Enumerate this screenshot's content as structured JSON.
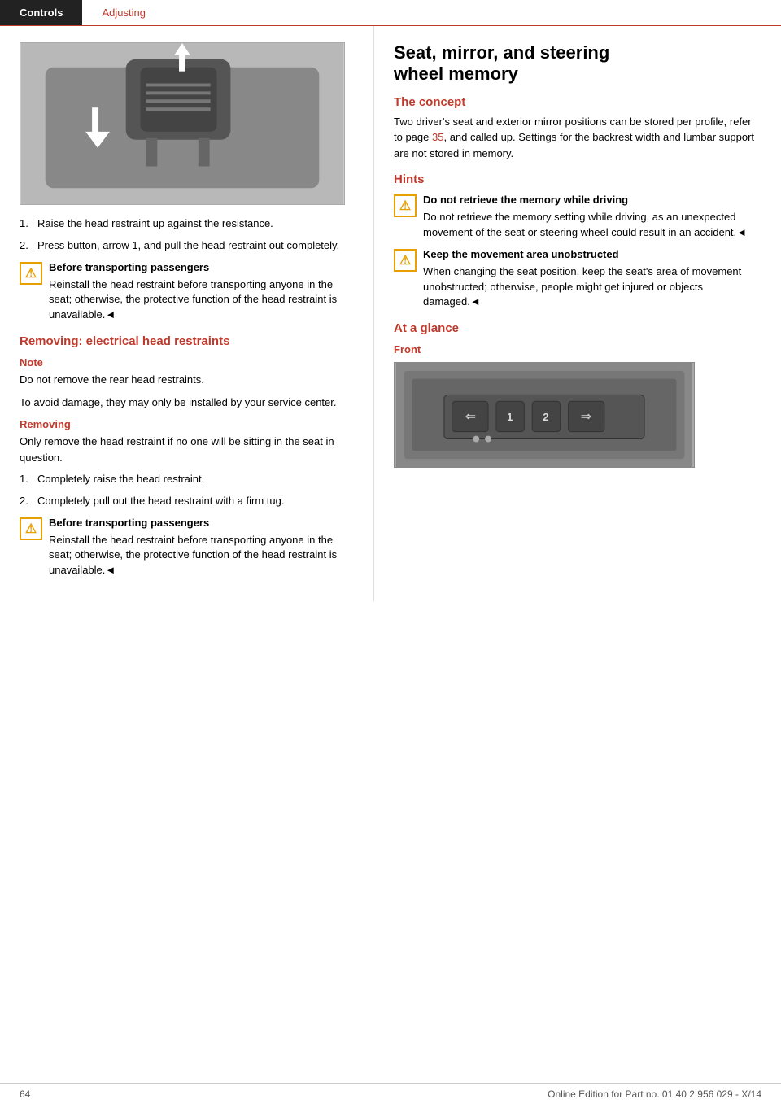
{
  "nav": {
    "tab1": "Controls",
    "tab2": "Adjusting"
  },
  "left": {
    "steps_remove_manual": [
      {
        "num": "1.",
        "text": "Raise the head restraint up against the resistance."
      },
      {
        "num": "2.",
        "text": "Press button, arrow 1, and pull the head restraint out completely."
      }
    ],
    "warning1": {
      "title": "Before transporting passengers",
      "text": "Reinstall the head restraint before transporting anyone in the seat; otherwise, the protective function of the head restraint is unavailable.◄"
    },
    "section_electrical": "Removing: electrical head restraints",
    "note_label": "Note",
    "note_text1": "Do not remove the rear head restraints.",
    "note_text2": "To avoid damage, they may only be installed by your service center.",
    "removing_label": "Removing",
    "removing_intro": "Only remove the head restraint if no one will be sitting in the seat in question.",
    "steps_remove_electrical": [
      {
        "num": "1.",
        "text": "Completely raise the head restraint."
      },
      {
        "num": "2.",
        "text": "Completely pull out the head restraint with a firm tug."
      }
    ],
    "warning2": {
      "title": "Before transporting passengers",
      "text": "Reinstall the head restraint before transporting anyone in the seat; otherwise, the protective function of the head restraint is unavailable.◄"
    }
  },
  "right": {
    "main_heading_line1": "Seat, mirror, and steering",
    "main_heading_line2": "wheel memory",
    "concept_heading": "The concept",
    "concept_text": "Two driver's seat and exterior mirror positions can be stored per profile, refer to page ",
    "concept_page_link": "35",
    "concept_text2": ", and called up. Settings for the backrest width and lumbar support are not stored in memory.",
    "hints_heading": "Hints",
    "hint1_title": "Do not retrieve the memory while driving",
    "hint1_text": "Do not retrieve the memory setting while driving, as an unexpected movement of the seat or steering wheel could result in an accident.◄",
    "hint2_title": "Keep the movement area unobstructed",
    "hint2_text": "When changing the seat position, keep the seat's area of movement unobstructed; otherwise, people might get injured or objects damaged.◄",
    "at_glance_heading": "At a glance",
    "front_label": "Front"
  },
  "footer": {
    "page_number": "64",
    "edition_text": "Online Edition for Part no. 01 40 2 956 029 - X/14"
  }
}
